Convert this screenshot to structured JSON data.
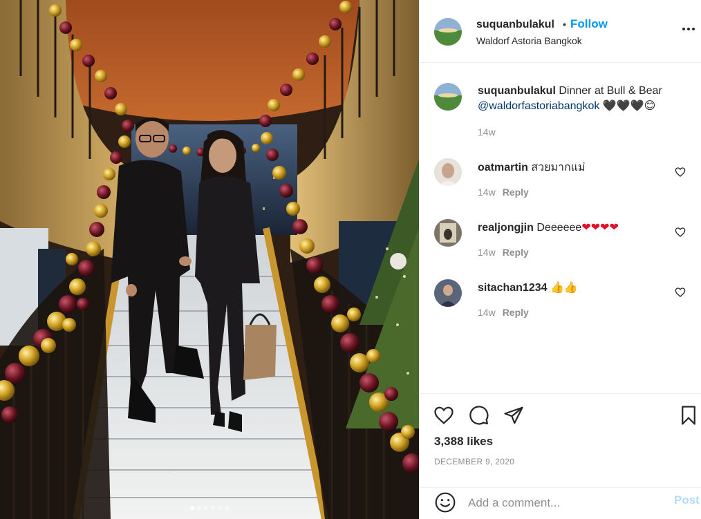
{
  "post": {
    "username": "suquanbulakul",
    "follow_label": "Follow",
    "bullet": "•",
    "location": "Waldorf Astoria Bangkok",
    "more_icon": "more-horizontal-icon",
    "photo_carousel": {
      "count": 6,
      "active_index": 0
    }
  },
  "comments": [
    {
      "username": "suquanbulakul",
      "text": "Dinner at Bull & Bear",
      "mention": "@waldorfastoriabangkok",
      "emoji": "🖤🖤🖤😊",
      "age": "14w"
    },
    {
      "username": "oatmartin",
      "text": "สวยมากแม่",
      "age": "14w",
      "reply_label": "Reply"
    },
    {
      "username": "realjongjin",
      "text": "Deeeeee",
      "emoji": "❤❤❤❤",
      "age": "14w",
      "reply_label": "Reply"
    },
    {
      "username": "sitachan1234",
      "text": "",
      "emoji": "👍👍",
      "age": "14w",
      "reply_label": "Reply"
    }
  ],
  "actions": {
    "like_icon": "heart-icon",
    "comment_icon": "comment-bubble-icon",
    "share_icon": "paper-plane-icon",
    "save_icon": "bookmark-icon",
    "likes": "3,388 likes",
    "date": "DECEMBER 9, 2020"
  },
  "add_comment": {
    "placeholder": "Add a comment...",
    "post_label": "Post",
    "emoji_icon": "smiley-icon"
  },
  "colors": {
    "link_blue": "#0095f6",
    "mention_blue": "#00376b",
    "post_disabled": "#b3dbff",
    "secondary_text": "#8e8e8e",
    "heart_red": "#e0102a"
  }
}
